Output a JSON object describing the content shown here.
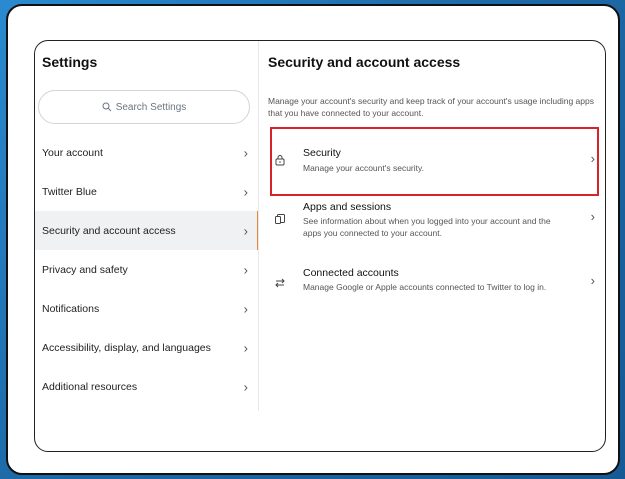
{
  "left": {
    "title": "Settings",
    "search_placeholder": "Search Settings",
    "items": [
      {
        "label": "Your account"
      },
      {
        "label": "Twitter Blue"
      },
      {
        "label": "Security and account access"
      },
      {
        "label": "Privacy and safety"
      },
      {
        "label": "Notifications"
      },
      {
        "label": "Accessibility, display, and languages"
      },
      {
        "label": "Additional resources"
      }
    ],
    "chevron": "›"
  },
  "right": {
    "title": "Security and account access",
    "description": "Manage your account's security and keep track of your account's usage including apps that you have connected to your account.",
    "options": [
      {
        "title": "Security",
        "subtitle": "Manage your account's security.",
        "icon": "lock-icon"
      },
      {
        "title": "Apps and sessions",
        "subtitle": "See information about when you logged into your account and the apps you connected to your account.",
        "icon": "devices-icon"
      },
      {
        "title": "Connected accounts",
        "subtitle": "Manage Google or Apple accounts connected to Twitter to log in.",
        "icon": "swap-arrows-icon"
      }
    ]
  },
  "colors": {
    "highlight": "#d8232a",
    "active_indicator": "#e58a3c",
    "background": "#1f6fb0"
  }
}
